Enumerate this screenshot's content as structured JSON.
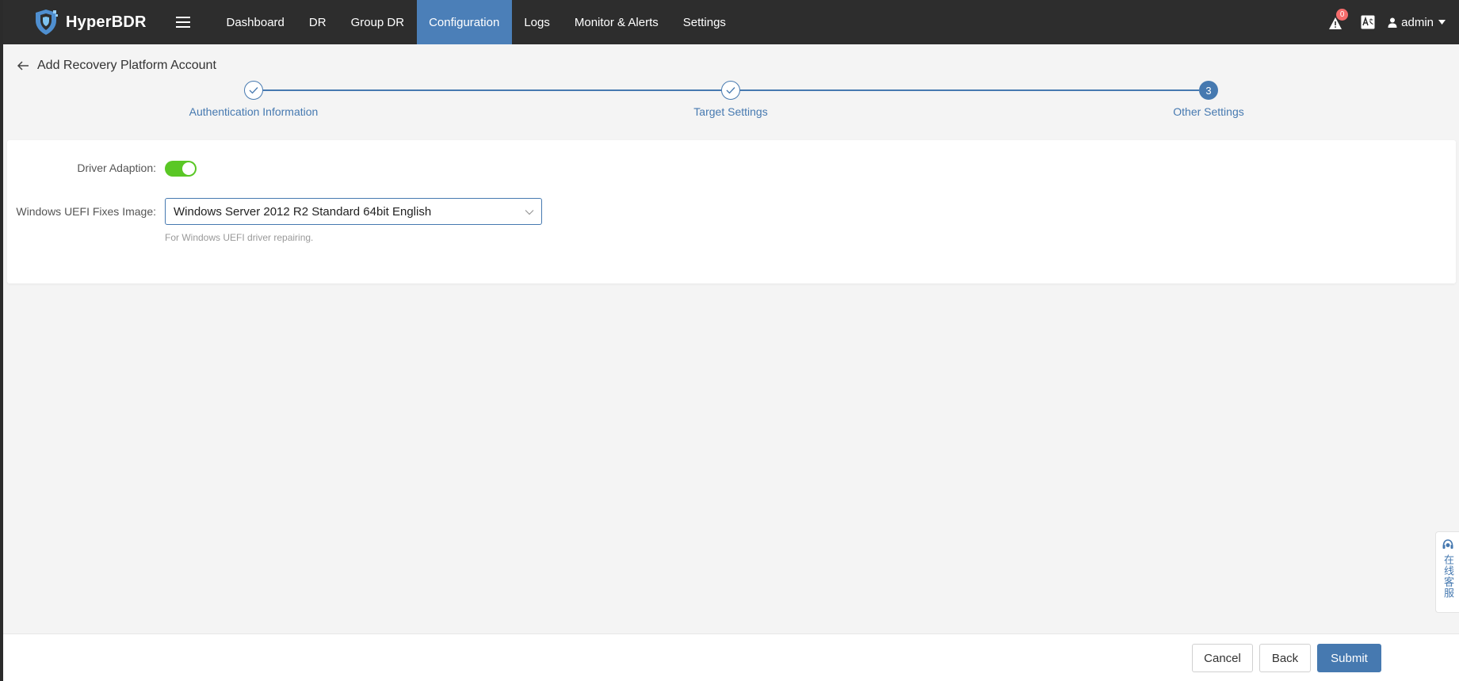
{
  "app": {
    "name": "HyperBDR"
  },
  "nav": {
    "items": [
      "Dashboard",
      "DR",
      "Group DR",
      "Configuration",
      "Logs",
      "Monitor & Alerts",
      "Settings"
    ],
    "active": "Configuration",
    "alert_count": "0",
    "user": "admin"
  },
  "page": {
    "title": "Add Recovery Platform Account"
  },
  "steps": [
    {
      "label": "Authentication Information",
      "status": "done"
    },
    {
      "label": "Target Settings",
      "status": "done"
    },
    {
      "label": "Other Settings",
      "status": "current",
      "number": "3"
    }
  ],
  "form": {
    "driver_adaption": {
      "label": "Driver Adaption:",
      "enabled": true
    },
    "uefi_image": {
      "label": "Windows UEFI Fixes Image:",
      "value": "Windows Server 2012 R2 Standard 64bit English",
      "hint": "For Windows UEFI driver repairing."
    }
  },
  "footer": {
    "cancel": "Cancel",
    "back": "Back",
    "submit": "Submit"
  },
  "service": {
    "label": "在线客服"
  },
  "colors": {
    "navbar": "#2d2d2d",
    "accent": "#4679b0",
    "toggle_on": "#5ac725"
  }
}
